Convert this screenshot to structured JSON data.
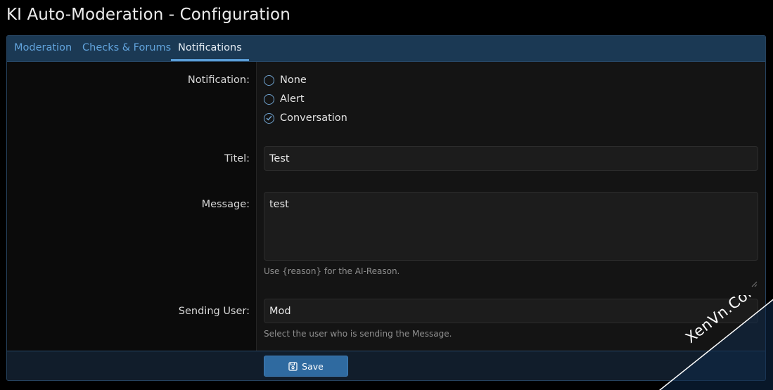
{
  "page": {
    "title": "KI Auto-Moderation - Configuration"
  },
  "tabs": [
    {
      "label": "Moderation",
      "active": false
    },
    {
      "label": "Checks & Forums",
      "active": false
    },
    {
      "label": "Notifications",
      "active": true
    }
  ],
  "form": {
    "notification": {
      "label": "Notification:",
      "options": [
        {
          "label": "None",
          "checked": false
        },
        {
          "label": "Alert",
          "checked": false
        },
        {
          "label": "Conversation",
          "checked": true
        }
      ]
    },
    "title": {
      "label": "Titel:",
      "value": "Test"
    },
    "message": {
      "label": "Message:",
      "value": "test",
      "hint": "Use {reason} for the AI-Reason."
    },
    "sending_user": {
      "label": "Sending User:",
      "value": "Mod",
      "hint": "Select the user who is sending the Message."
    }
  },
  "footer": {
    "save_label": "Save"
  },
  "watermark": {
    "text": "XenVn.Com"
  },
  "colors": {
    "accent": "#5a9dd6",
    "button": "#2f6aa0",
    "tab_bar": "#1b3954"
  }
}
